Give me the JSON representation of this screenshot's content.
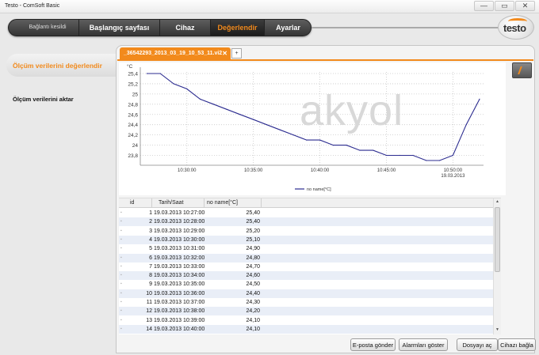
{
  "window": {
    "title": "Testo - ComSoft Basic",
    "controls": [
      "—",
      "▭",
      "✕"
    ]
  },
  "nav": {
    "items": [
      {
        "label": "Bağlantı kesildi"
      },
      {
        "label": "Başlangıç sayfası"
      },
      {
        "label": "Cihaz"
      },
      {
        "label": "Değerlendir",
        "active": true
      },
      {
        "label": "Ayarlar"
      }
    ],
    "logo": "testo",
    "accent": "#f28a1c"
  },
  "sidebar": {
    "active_item": "Ölçüm verilerini değerlendir",
    "items": [
      "Ölçüm verilerini aktar"
    ]
  },
  "document_tab": {
    "label": "_36542293_2013_03_19_10_53_11.vi2",
    "close": "✕",
    "add": "+"
  },
  "watermark": "akyol",
  "chart_data": {
    "type": "line",
    "ylabel": "°C",
    "ylim": [
      23.6,
      25.5
    ],
    "yticks": [
      "25,4",
      "25,2",
      "25",
      "24,8",
      "24,6",
      "24,4",
      "24,2",
      "24",
      "23,8"
    ],
    "xticks": [
      "10:30:00",
      "10:35:00",
      "10:40:00",
      "10:45:00",
      "10:50:00"
    ],
    "xtick_date": "19.03.2013",
    "series": [
      {
        "name": "no name[°C]",
        "color": "#2b2b8f",
        "x": [
          "10:27:00",
          "10:28:00",
          "10:29:00",
          "10:30:00",
          "10:31:00",
          "10:32:00",
          "10:33:00",
          "10:34:00",
          "10:35:00",
          "10:36:00",
          "10:37:00",
          "10:38:00",
          "10:39:00",
          "10:40:00",
          "10:41:00",
          "10:42:00",
          "10:43:00",
          "10:44:00",
          "10:45:00",
          "10:46:00",
          "10:47:00",
          "10:48:00",
          "10:49:00",
          "10:50:00",
          "10:51:00",
          "10:52:00"
        ],
        "values": [
          25.4,
          25.4,
          25.2,
          25.1,
          24.9,
          24.8,
          24.7,
          24.6,
          24.5,
          24.4,
          24.3,
          24.2,
          24.1,
          24.1,
          24.0,
          24.0,
          23.9,
          23.9,
          23.8,
          23.8,
          23.8,
          23.7,
          23.7,
          23.8,
          24.4,
          24.9
        ]
      }
    ],
    "grid": true,
    "legend": "bottom"
  },
  "table": {
    "columns": [
      "id",
      "Tarih/Saat",
      "no name[°C]"
    ],
    "rows": [
      [
        "1",
        "19.03.2013 10:27:00",
        "25,40"
      ],
      [
        "2",
        "19.03.2013 10:28:00",
        "25,40"
      ],
      [
        "3",
        "19.03.2013 10:29:00",
        "25,20"
      ],
      [
        "4",
        "19.03.2013 10:30:00",
        "25,10"
      ],
      [
        "5",
        "19.03.2013 10:31:00",
        "24,90"
      ],
      [
        "6",
        "19.03.2013 10:32:00",
        "24,80"
      ],
      [
        "7",
        "19.03.2013 10:33:00",
        "24,70"
      ],
      [
        "8",
        "19.03.2013 10:34:00",
        "24,60"
      ],
      [
        "9",
        "19.03.2013 10:35:00",
        "24,50"
      ],
      [
        "10",
        "19.03.2013 10:36:00",
        "24,40"
      ],
      [
        "11",
        "19.03.2013 10:37:00",
        "24,30"
      ],
      [
        "12",
        "19.03.2013 10:38:00",
        "24,20"
      ],
      [
        "13",
        "19.03.2013 10:39:00",
        "24,10"
      ],
      [
        "14",
        "19.03.2013 10:40:00",
        "24,10"
      ]
    ]
  },
  "buttons": {
    "email": "E-posta gönder",
    "alarms": "Alarmları göster",
    "open_file": "Dosyayı aç",
    "connect": "Cihazı bağla"
  }
}
